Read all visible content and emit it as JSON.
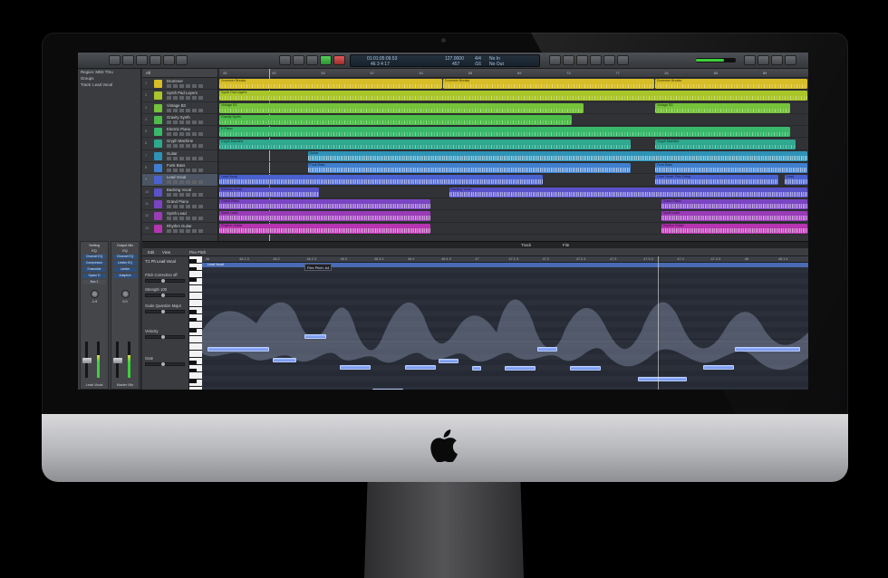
{
  "lcd": {
    "position_time": "01:01:05:09.53",
    "position_bars": "46 3 4 17",
    "tempo": "127.0000",
    "signature": "4/4",
    "signature_division": "/16",
    "keys_in": "No In",
    "keys_out": "No Out",
    "tempo_sub": "457"
  },
  "inspector": {
    "row1": "Region: MIDI Thru",
    "row2": "Groups",
    "row3": "Track: Lead Vocal",
    "strip_left": {
      "label": "Setting",
      "eq": "EQ",
      "plugins": [
        "Channel EQ",
        "Compressor",
        "Ensemble",
        "Space D"
      ],
      "bus": "Bus 1",
      "name": "Lead Vocal",
      "meter": "-1.9"
    },
    "strip_right": {
      "label": "Output Mix",
      "eq": "EQ",
      "plugins": [
        "Channel EQ",
        "Limiter EQ",
        "Limiter",
        "Adaptive"
      ],
      "name": "Master Mix",
      "meter": "0.0"
    }
  },
  "track_header_top": "All",
  "tracks": [
    {
      "num": "1",
      "name": "Drummer",
      "color": "#d7bd27",
      "regions": [
        {
          "name": "Drummer Breaks",
          "s": 0.0,
          "e": 0.38
        },
        {
          "name": "Drummer Breaks",
          "s": 0.38,
          "e": 0.74
        },
        {
          "name": "Drummer Breaks",
          "s": 0.74,
          "e": 1.0
        }
      ]
    },
    {
      "num": "2",
      "name": "Synth Pad Layers",
      "color": "#a9c52a",
      "regions": [
        {
          "name": "Synth Pad Layers",
          "s": 0.0,
          "e": 1.0
        }
      ]
    },
    {
      "num": "3",
      "name": "Vintage B3",
      "color": "#76c23a",
      "regions": [
        {
          "name": "Vintage B3",
          "s": 0.0,
          "e": 0.62
        },
        {
          "name": "Vintage B3",
          "s": 0.74,
          "e": 0.97
        }
      ]
    },
    {
      "num": "4",
      "name": "Gravity Synth",
      "color": "#4dbd4a",
      "regions": [
        {
          "name": "Gravity Synth",
          "s": 0.0,
          "e": 0.6
        }
      ]
    },
    {
      "num": "5",
      "name": "Electric Piano",
      "color": "#38b86b",
      "regions": [
        {
          "name": "E.Piano",
          "s": 0.0,
          "e": 0.97
        }
      ]
    },
    {
      "num": "6",
      "name": "Gryph Machine",
      "color": "#2ea88f",
      "regions": [
        {
          "name": "Gryph Machine",
          "s": 0.0,
          "e": 0.7
        },
        {
          "name": "Gryph Machine",
          "s": 0.74,
          "e": 0.98
        }
      ]
    },
    {
      "num": "7",
      "name": "Guitar",
      "color": "#2f93b7",
      "regions": [
        {
          "name": "Guitar",
          "s": 0.15,
          "e": 1.0
        }
      ]
    },
    {
      "num": "8",
      "name": "Funk Bass",
      "color": "#3f7fcf",
      "regions": [
        {
          "name": "Funk Bass",
          "s": 0.15,
          "e": 0.7
        },
        {
          "name": "Funk Bass",
          "s": 0.74,
          "e": 1.0
        }
      ]
    },
    {
      "num": "9",
      "name": "Lead Vocal",
      "color": "#4a62cf",
      "selected": true,
      "regions": [
        {
          "name": "Lead Vocal",
          "s": 0.0,
          "e": 0.55
        },
        {
          "name": "Lead Vocal: Flex Comp",
          "s": 0.74,
          "e": 0.95
        },
        {
          "name": "Lead",
          "s": 0.96,
          "e": 1.0
        }
      ]
    },
    {
      "num": "10",
      "name": "Backing Vocal",
      "color": "#5a52c9",
      "regions": [
        {
          "name": "Backing Vocal",
          "s": 0.0,
          "e": 0.17
        },
        {
          "name": "Backing Vocal",
          "s": 0.39,
          "e": 1.0
        }
      ]
    },
    {
      "num": "11",
      "name": "Grand Piano",
      "color": "#7a44c2",
      "regions": [
        {
          "name": "Grand Piano",
          "s": 0.0,
          "e": 0.36
        },
        {
          "name": "Grand Piano",
          "s": 0.75,
          "e": 1.0
        }
      ]
    },
    {
      "num": "12",
      "name": "Synth Lead",
      "color": "#9a3bb8",
      "regions": [
        {
          "name": "Synth Lead",
          "s": 0.0,
          "e": 0.36
        },
        {
          "name": "Synth Lead",
          "s": 0.75,
          "e": 1.0
        }
      ]
    },
    {
      "num": "13",
      "name": "Rhythm Guitar",
      "color": "#b634b0",
      "regions": [
        {
          "name": "Rhythm Guitar",
          "s": 0.0,
          "e": 0.36
        },
        {
          "name": "Rhythm Guitar",
          "s": 0.75,
          "e": 1.0
        }
      ]
    }
  ],
  "ruler_marks": [
    "45",
    "49",
    "53",
    "57",
    "61",
    "65",
    "69",
    "73",
    "77",
    "81",
    "85",
    "89"
  ],
  "editor_tabs": {
    "track": "Track",
    "file": "File"
  },
  "editor_toolbar": {
    "edit": "Edit",
    "view": "View",
    "mode": "Flex Pitch"
  },
  "editor_left": {
    "region": "T:1 Ph Lead Vocal",
    "pitch_correction": "Pitch Correction",
    "pitch_value": "off",
    "strength": "Strength",
    "strength_value": "100",
    "scale_quantize": "Scale Quantize",
    "scale_value": "Major",
    "velocity": "Velocity",
    "gate": "Gate"
  },
  "pitch_ruler": [
    "46",
    "46.1.3",
    "46.2",
    "46.2.3",
    "46.3",
    "46.3.3",
    "46.4",
    "46.4.3",
    "47",
    "47.1.3",
    "47.2",
    "47.2.3",
    "47.3",
    "47.3.3",
    "47.4",
    "47.4.3",
    "48",
    "48.1.3"
  ],
  "region_strip_label": "Lead Vocal",
  "flex_tip": "Flex Pitch: A4"
}
